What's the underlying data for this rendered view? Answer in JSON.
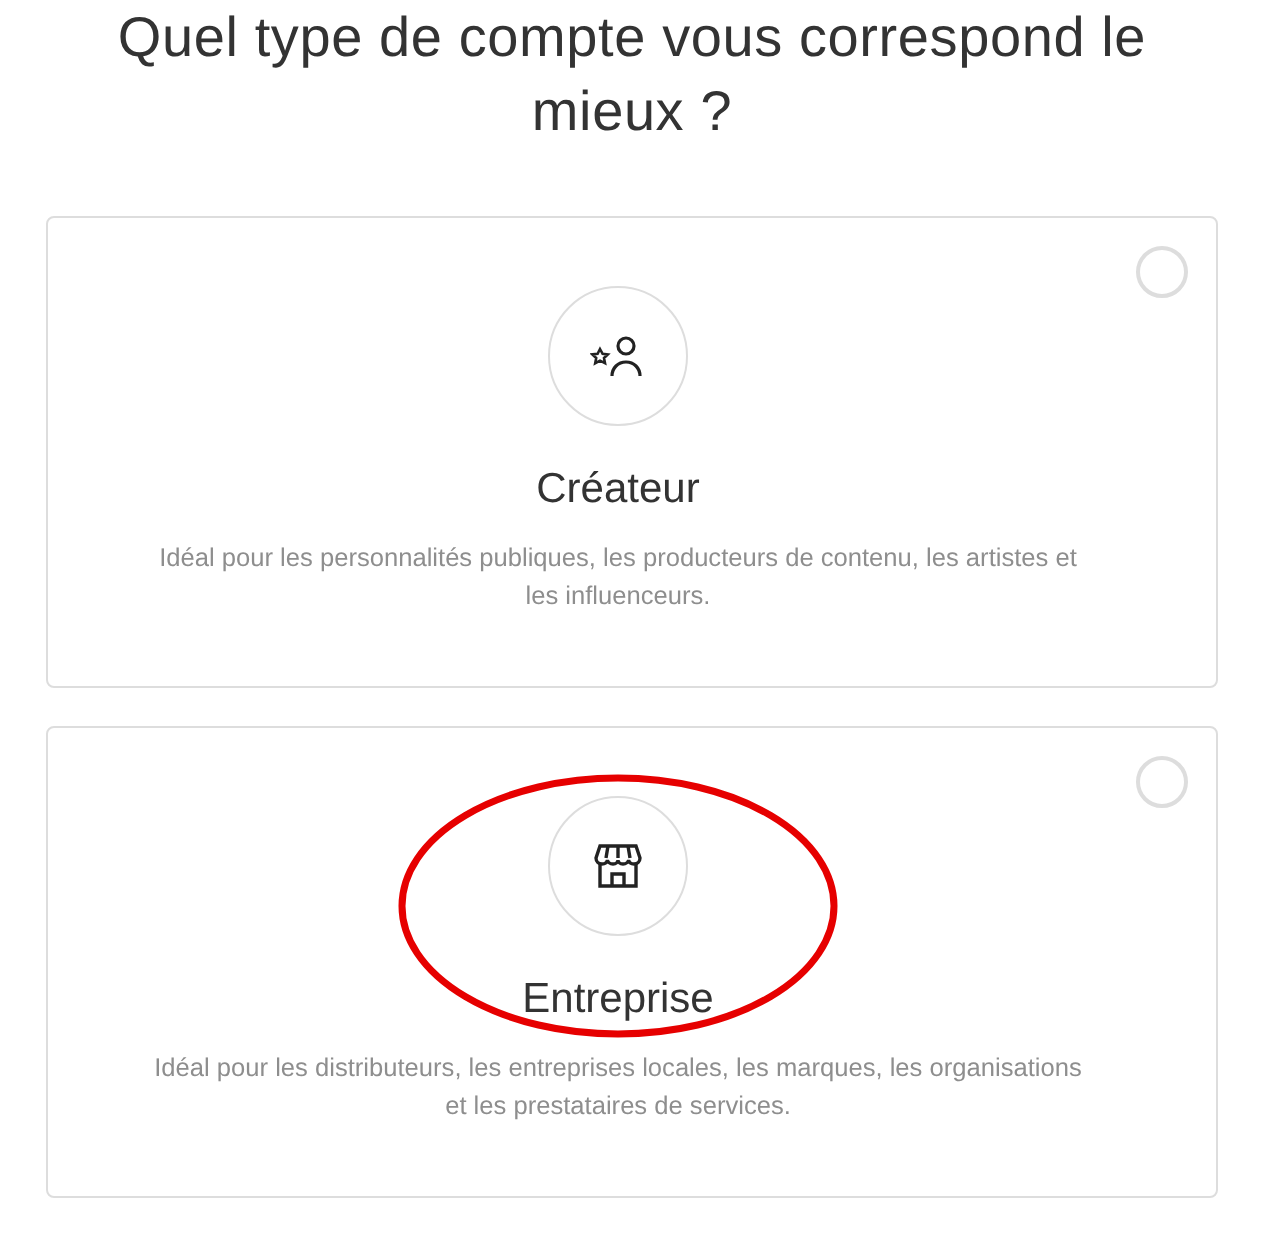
{
  "heading": "Quel type de compte vous correspond le mieux ?",
  "options": [
    {
      "kind": "creator",
      "title": "Créateur",
      "description": "Idéal pour les personnalités publiques, les producteurs de contenu, les artistes et les influenceurs.",
      "selected": false,
      "annotated": false
    },
    {
      "kind": "business",
      "title": "Entreprise",
      "description": "Idéal pour les distributeurs, les entreprises locales, les marques, les organisations et les prestataires de services.",
      "selected": false,
      "annotated": true
    }
  ]
}
